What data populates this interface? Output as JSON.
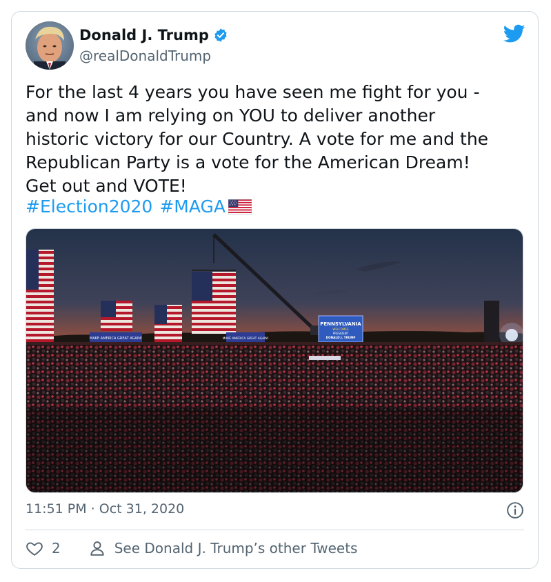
{
  "tweet": {
    "author_name": "Donald J. Trump",
    "handle": "@realDonaldTrump",
    "text": "For the last 4 years you have seen me fight for you -\nand now I am relying on YOU to deliver another\nhistoric victory for our Country. A vote for me and the\nRepublican Party is a vote for the American Dream!\nGet out and VOTE!",
    "hashtags": [
      "#Election2020",
      "#MAGA"
    ],
    "timestamp": "11:51 PM · Oct 31, 2020",
    "like_count": "2",
    "other_tweets_label": "See Donald J. Trump’s other Tweets"
  },
  "media": {
    "banner_main": "PENNSYLVANIA",
    "banner_sub": "WELCOMES",
    "banner_president": "PRESIDENT",
    "banner_name": "DONALD J. TRUMP",
    "sign_left": "MAKE AMERICA GREAT AGAIN!",
    "sign_right": "MAKE AMERICA GREAT AGAIN!"
  },
  "colors": {
    "accent": "#1d9bf0",
    "text": "#0f1419",
    "muted": "#536471",
    "border": "#cfd9de"
  },
  "icons": [
    "verified-badge-icon",
    "twitter-bird-icon",
    "us-flag-icon",
    "info-icon",
    "heart-icon",
    "person-icon"
  ]
}
